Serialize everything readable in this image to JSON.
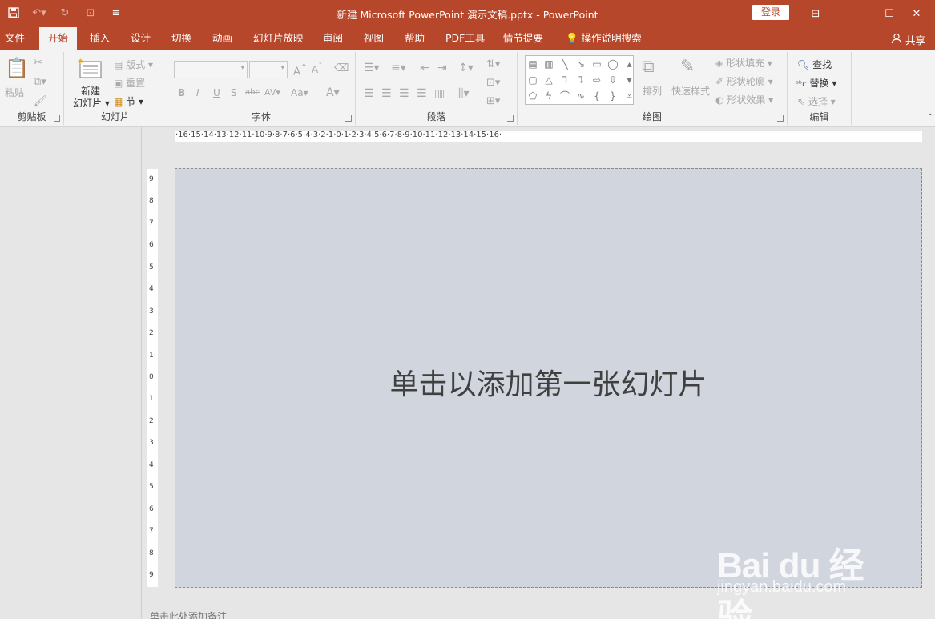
{
  "title": "新建 Microsoft PowerPoint 演示文稿.pptx  -  PowerPoint",
  "login_label": "登录",
  "share_label": "共享",
  "tabs": [
    "文件",
    "开始",
    "插入",
    "设计",
    "切换",
    "动画",
    "幻灯片放映",
    "审阅",
    "视图",
    "帮助",
    "PDF工具",
    "情节提要",
    "操作说明搜索"
  ],
  "active_tab": "开始",
  "groups": {
    "clipboard": {
      "label": "剪贴板",
      "paste": "粘贴"
    },
    "slides": {
      "label": "幻灯片",
      "new_slide_line1": "新建",
      "new_slide_line2": "幻灯片",
      "layout": "版式",
      "reset": "重置",
      "section": "节"
    },
    "font": {
      "label": "字体"
    },
    "paragraph": {
      "label": "段落"
    },
    "drawing": {
      "label": "绘图",
      "arrange": "排列",
      "quick_styles": "快速样式",
      "fill": "形状填充",
      "outline": "形状轮廓",
      "effects": "形状效果"
    },
    "editing": {
      "label": "编辑",
      "find": "查找",
      "replace": "替换",
      "select": "选择"
    }
  },
  "horizontal_ruler": "·16·15·14·13·12·11·10·9·8·7·6·5·4·3·2·1·0·1·2·3·4·5·6·7·8·9·10·11·12·13·14·15·16·",
  "vertical_ruler": [
    "9",
    "8",
    "7",
    "6",
    "5",
    "4",
    "3",
    "2",
    "1",
    "0",
    "1",
    "2",
    "3",
    "4",
    "5",
    "6",
    "7",
    "8",
    "9"
  ],
  "slide_placeholder": "单击以添加第一张幻灯片",
  "notes_placeholder": "单击此处添加备注",
  "watermark": {
    "brand": "Bai du 经验",
    "url": "jingyan.baidu.com"
  },
  "colors": {
    "accent": "#b7472a",
    "ribbon": "#f3f3f3",
    "slide": "#d0d5de"
  }
}
